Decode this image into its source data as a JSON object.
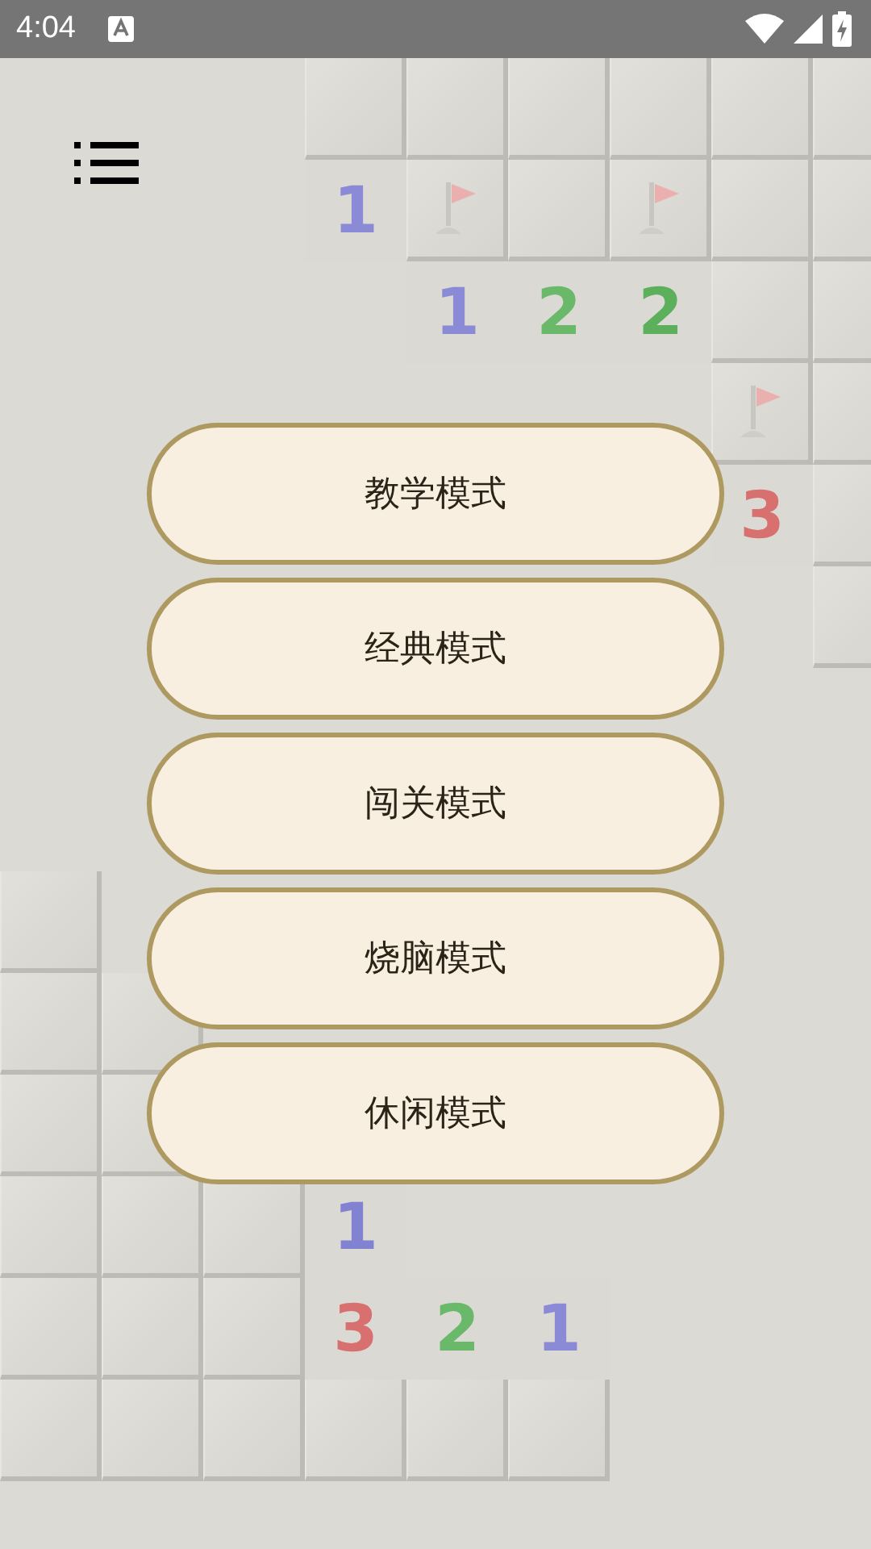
{
  "status_bar": {
    "time": "4:04"
  },
  "board": {
    "rows": [
      [
        {
          "kind": "blank"
        },
        {
          "kind": "blank"
        },
        {
          "kind": "blank"
        },
        {
          "kind": "tile"
        },
        {
          "kind": "tile"
        },
        {
          "kind": "tile"
        },
        {
          "kind": "tile"
        },
        {
          "kind": "tile"
        },
        {
          "kind": "tile"
        }
      ],
      [
        {
          "kind": "blank"
        },
        {
          "kind": "blank"
        },
        {
          "kind": "blank"
        },
        {
          "kind": "number",
          "text": "1",
          "color": "#8a8ad6"
        },
        {
          "kind": "flag"
        },
        {
          "kind": "tile"
        },
        {
          "kind": "flag"
        },
        {
          "kind": "tile"
        },
        {
          "kind": "tile"
        }
      ],
      [
        {
          "kind": "blank"
        },
        {
          "kind": "blank"
        },
        {
          "kind": "blank"
        },
        {
          "kind": "blank"
        },
        {
          "kind": "number",
          "text": "1",
          "color": "#8a8ad6"
        },
        {
          "kind": "number",
          "text": "2",
          "color": "#6ab86a"
        },
        {
          "kind": "number",
          "text": "2",
          "color": "#5cb05c"
        },
        {
          "kind": "tile"
        },
        {
          "kind": "tile"
        }
      ],
      [
        {
          "kind": "blank"
        },
        {
          "kind": "blank"
        },
        {
          "kind": "blank"
        },
        {
          "kind": "blank"
        },
        {
          "kind": "blank"
        },
        {
          "kind": "blank"
        },
        {
          "kind": "blank"
        },
        {
          "kind": "flag"
        },
        {
          "kind": "tile"
        }
      ],
      [
        {
          "kind": "blank"
        },
        {
          "kind": "blank"
        },
        {
          "kind": "blank"
        },
        {
          "kind": "blank"
        },
        {
          "kind": "blank"
        },
        {
          "kind": "blank"
        },
        {
          "kind": "blank"
        },
        {
          "kind": "number",
          "text": "3",
          "color": "#d87070"
        },
        {
          "kind": "tile"
        }
      ],
      [
        {
          "kind": "blank"
        },
        {
          "kind": "blank"
        },
        {
          "kind": "blank"
        },
        {
          "kind": "blank"
        },
        {
          "kind": "blank"
        },
        {
          "kind": "blank"
        },
        {
          "kind": "blank"
        },
        {
          "kind": "blank"
        },
        {
          "kind": "tile"
        }
      ],
      [
        {
          "kind": "blank"
        },
        {
          "kind": "blank"
        },
        {
          "kind": "blank"
        },
        {
          "kind": "blank"
        },
        {
          "kind": "blank"
        },
        {
          "kind": "blank"
        },
        {
          "kind": "blank"
        },
        {
          "kind": "blank"
        },
        {
          "kind": "blank"
        }
      ],
      [
        {
          "kind": "blank"
        },
        {
          "kind": "blank"
        },
        {
          "kind": "blank"
        },
        {
          "kind": "blank"
        },
        {
          "kind": "blank"
        },
        {
          "kind": "blank"
        },
        {
          "kind": "blank"
        },
        {
          "kind": "blank"
        },
        {
          "kind": "blank"
        }
      ],
      [
        {
          "kind": "tile"
        },
        {
          "kind": "blank"
        },
        {
          "kind": "blank"
        },
        {
          "kind": "blank"
        },
        {
          "kind": "blank"
        },
        {
          "kind": "blank"
        },
        {
          "kind": "blank"
        },
        {
          "kind": "blank"
        },
        {
          "kind": "blank"
        }
      ],
      [
        {
          "kind": "tile"
        },
        {
          "kind": "tile"
        },
        {
          "kind": "blank"
        },
        {
          "kind": "blank"
        },
        {
          "kind": "blank"
        },
        {
          "kind": "blank"
        },
        {
          "kind": "blank"
        },
        {
          "kind": "blank"
        },
        {
          "kind": "blank"
        }
      ],
      [
        {
          "kind": "tile"
        },
        {
          "kind": "tile"
        },
        {
          "kind": "blank"
        },
        {
          "kind": "blank"
        },
        {
          "kind": "blank"
        },
        {
          "kind": "blank"
        },
        {
          "kind": "blank"
        },
        {
          "kind": "blank"
        },
        {
          "kind": "blank"
        }
      ],
      [
        {
          "kind": "tile"
        },
        {
          "kind": "tile"
        },
        {
          "kind": "tile"
        },
        {
          "kind": "number",
          "text": "1",
          "color": "#8282d2"
        },
        {
          "kind": "blank"
        },
        {
          "kind": "blank"
        },
        {
          "kind": "blank"
        },
        {
          "kind": "blank"
        },
        {
          "kind": "blank"
        }
      ],
      [
        {
          "kind": "tile"
        },
        {
          "kind": "tile"
        },
        {
          "kind": "tile"
        },
        {
          "kind": "number",
          "text": "3",
          "color": "#d87070"
        },
        {
          "kind": "number",
          "text": "2",
          "color": "#6ab86a"
        },
        {
          "kind": "number",
          "text": "1",
          "color": "#8a8ad6"
        },
        {
          "kind": "blank"
        },
        {
          "kind": "blank"
        },
        {
          "kind": "blank"
        }
      ],
      [
        {
          "kind": "tile"
        },
        {
          "kind": "tile"
        },
        {
          "kind": "tile"
        },
        {
          "kind": "tile"
        },
        {
          "kind": "tile"
        },
        {
          "kind": "tile"
        },
        {
          "kind": "blank"
        },
        {
          "kind": "blank"
        },
        {
          "kind": "blank"
        }
      ]
    ]
  },
  "modes": [
    {
      "label": "教学模式"
    },
    {
      "label": "经典模式"
    },
    {
      "label": "闯关模式"
    },
    {
      "label": "烧脑模式"
    },
    {
      "label": "休闲模式"
    }
  ]
}
